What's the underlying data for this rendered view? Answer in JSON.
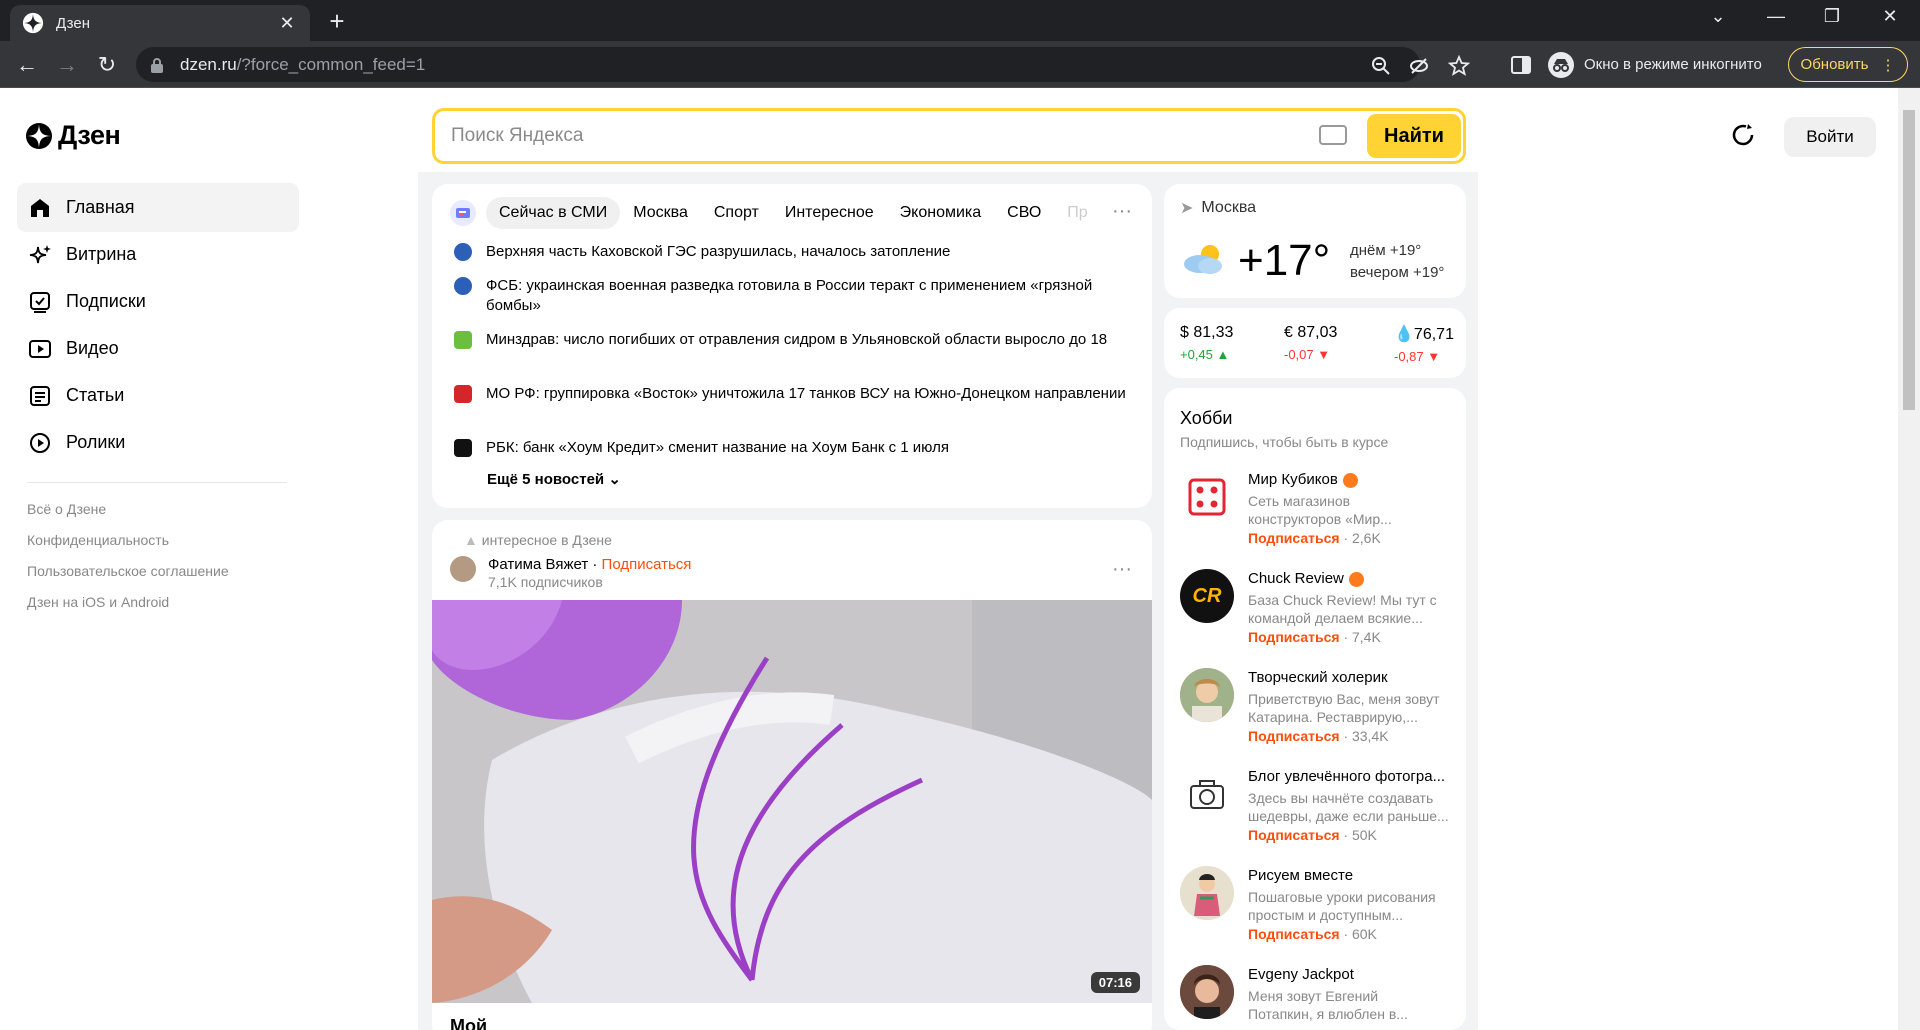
{
  "browser": {
    "tab_title": "Дзен",
    "url_host": "dzen.ru",
    "url_path": "/?force_common_feed=1",
    "incognito_label": "Окно в режиме инкогнито",
    "update_label": "Обновить"
  },
  "header": {
    "logo_text": "Дзен",
    "search_placeholder": "Поиск Яндекса",
    "search_button": "Найти",
    "login_button": "Войти"
  },
  "nav": {
    "items": [
      {
        "label": "Главная",
        "icon": "home-icon"
      },
      {
        "label": "Витрина",
        "icon": "sparkle-icon"
      },
      {
        "label": "Подписки",
        "icon": "subscriptions-icon"
      },
      {
        "label": "Видео",
        "icon": "video-icon"
      },
      {
        "label": "Статьи",
        "icon": "articles-icon"
      },
      {
        "label": "Ролики",
        "icon": "clips-icon"
      }
    ],
    "footer_links": [
      "Всё о Дзене",
      "Конфиденциальность",
      "Пользовательское соглашение",
      "Дзен на iOS и Android"
    ]
  },
  "news": {
    "tabs": [
      "Сейчас в СМИ",
      "Москва",
      "Спорт",
      "Интересное",
      "Экономика",
      "СВО",
      "Пр"
    ],
    "items": [
      {
        "text": "Верхняя часть Каховской ГЭС разрушилась, началось затопление",
        "src_color": "#2b5fb8"
      },
      {
        "text": "ФСБ: украинская военная разведка готовила в России теракт с применением «грязной бомбы»",
        "src_color": "#2b5fb8"
      },
      {
        "text": "Минздрав: число погибших от отравления сидром в Ульяновской области выросло до 18",
        "src_color": "#6cbf3e"
      },
      {
        "text": "МО РФ: группировка «Восток» уничтожила 17 танков ВСУ на Южно-Донецком направлении",
        "src_color": "#d4262a"
      },
      {
        "text": "РБК: банк «Хоум Кредит» сменит название на Хоум Банк с 1 июля",
        "src_color": "#111111"
      }
    ],
    "more_label": "Ещё 5 новостей"
  },
  "post": {
    "header": "интересное в Дзене",
    "author": "Фатима Вяжет",
    "subscribe": "Подписаться",
    "subscribers": "7,1K подписчиков",
    "duration": "07:16",
    "caption": "Мой"
  },
  "weather": {
    "city": "Москва",
    "temp": "+17°",
    "day": "днём +19°",
    "evening": "вечером +19°"
  },
  "rates": [
    {
      "label": "$ 81,33",
      "change": "+0,45 ▲",
      "dir": "up"
    },
    {
      "label": "€ 87,03",
      "change": "-0,07 ▼",
      "dir": "down"
    },
    {
      "label": "76,71",
      "change": "-0,87 ▼",
      "dir": "down"
    }
  ],
  "hobby": {
    "title": "Хобби",
    "subtitle": "Подпишись, чтобы быть в курсе",
    "channels": [
      {
        "name": "Мир Кубиков",
        "verified": true,
        "desc1": "Сеть магазинов",
        "desc2": "конструкторов «Мир...",
        "subscribe": "Подписаться",
        "count": "· 2,6K"
      },
      {
        "name": "Chuck Review",
        "verified": true,
        "desc1": "База Chuck Review! Мы тут с",
        "desc2": "командой делаем всякие...",
        "subscribe": "Подписаться",
        "count": "· 7,4K"
      },
      {
        "name": "Творческий холерик",
        "verified": false,
        "desc1": "Приветствую Вас, меня зовут",
        "desc2": "Катарина. Реставрирую,...",
        "subscribe": "Подписаться",
        "count": "· 33,4K"
      },
      {
        "name": "Блог увлечённого фотогра...",
        "verified": false,
        "desc1": "Здесь вы начнёте создавать",
        "desc2": "шедевры, даже если раньше...",
        "subscribe": "Подписаться",
        "count": "· 50K"
      },
      {
        "name": "Рисуем вместе",
        "verified": false,
        "desc1": "Пошаговые уроки рисования",
        "desc2": "простым и доступным...",
        "subscribe": "Подписаться",
        "count": "· 60K"
      },
      {
        "name": "Evgeny Jackpot",
        "verified": false,
        "desc1": "Меня зовут Евгений",
        "desc2": "Потапкин, я влюблен в...",
        "subscribe": "",
        "count": ""
      }
    ]
  },
  "colors": {
    "accent": "#ffd334",
    "subscribe": "#ff4e0a",
    "up": "#1aa839",
    "down": "#ff3333"
  }
}
